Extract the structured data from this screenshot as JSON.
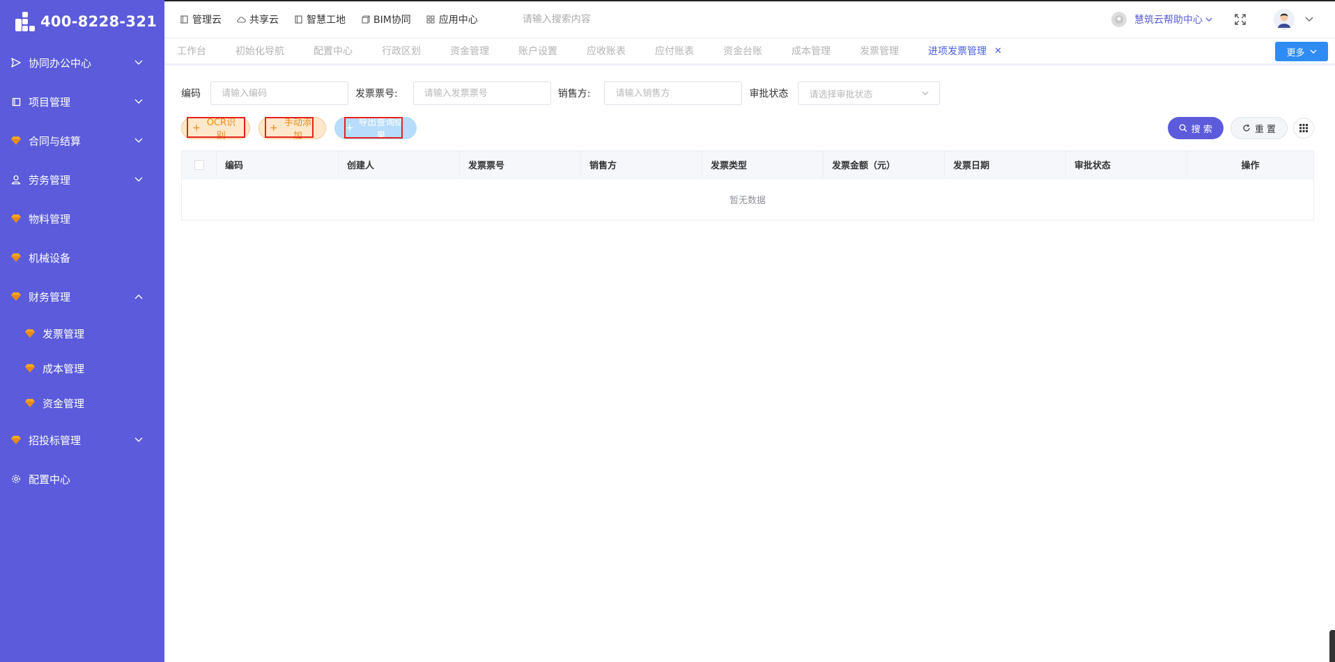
{
  "brand": {
    "phone": "400-8228-321"
  },
  "sidebar": {
    "items": [
      {
        "label": "协同办公中心",
        "icon": "send-icon",
        "expandable": true,
        "expanded": false
      },
      {
        "label": "项目管理",
        "icon": "book-icon",
        "expandable": true,
        "expanded": false
      },
      {
        "label": "合同与结算",
        "icon": "gem-icon",
        "expandable": true,
        "expanded": false
      },
      {
        "label": "劳务管理",
        "icon": "user-icon",
        "expandable": true,
        "expanded": false
      },
      {
        "label": "物料管理",
        "icon": "gem-icon",
        "expandable": false
      },
      {
        "label": "机械设备",
        "icon": "gem-icon",
        "expandable": false
      },
      {
        "label": "财务管理",
        "icon": "gem-icon",
        "expandable": true,
        "expanded": true
      },
      {
        "label": "招投标管理",
        "icon": "gem-icon",
        "expandable": true,
        "expanded": false
      },
      {
        "label": "配置中心",
        "icon": "gear-icon",
        "expandable": false
      }
    ],
    "finance_sub": [
      {
        "label": "发票管理",
        "icon": "gem-icon"
      },
      {
        "label": "成本管理",
        "icon": "gem-icon"
      },
      {
        "label": "资金管理",
        "icon": "gem-icon"
      }
    ]
  },
  "topnav": {
    "items": [
      {
        "label": "管理云",
        "icon": "doc-icon"
      },
      {
        "label": "共享云",
        "icon": "cloud-icon"
      },
      {
        "label": "智慧工地",
        "icon": "doc-icon"
      },
      {
        "label": "BIM协同",
        "icon": "cube-icon"
      },
      {
        "label": "应用中心",
        "icon": "apps-icon"
      }
    ],
    "search_placeholder": "请输入搜索内容",
    "help_label": "慧筑云帮助中心"
  },
  "tabs": {
    "items": [
      "工作台",
      "初始化导航",
      "配置中心",
      "行政区划",
      "资金管理",
      "账户设置",
      "应收账表",
      "应付账表",
      "资金台账",
      "成本管理",
      "发票管理"
    ],
    "active": "进项发票管理",
    "more_label": "更多"
  },
  "filters": {
    "code_label": "编码",
    "code_placeholder": "请输入编码",
    "invoice_no_label": "发票票号:",
    "invoice_no_placeholder": "请输入发票票号",
    "seller_label": "销售方:",
    "seller_placeholder": "请输入销售方",
    "status_label": "审批状态",
    "status_placeholder": "请选择审批状态"
  },
  "actions": {
    "ocr_label": "OCR识别",
    "manual_add_label": "手动添加",
    "export_label": "导出查询结果",
    "search_label": "搜 索",
    "reset_label": "重 置"
  },
  "table": {
    "columns": [
      "编码",
      "创建人",
      "发票票号",
      "销售方",
      "发票类型",
      "发票金额（元）",
      "发票日期",
      "审批状态",
      "操作"
    ],
    "empty_text": "暂无数据"
  },
  "colors": {
    "sidebar_bg": "#5b5bdb",
    "primary": "#5b5bdb",
    "tab_active": "#4a5fe0",
    "more_button": "#2f8cf5",
    "highlight_box": "#e3221c"
  }
}
